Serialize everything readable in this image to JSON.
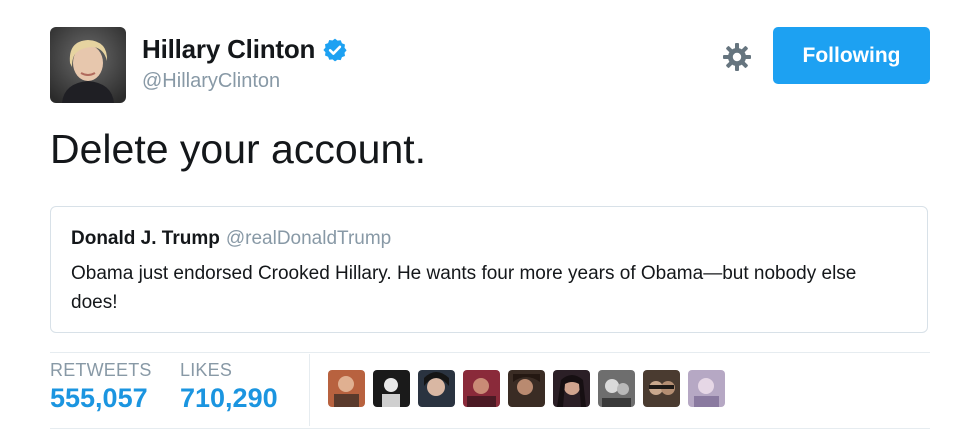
{
  "author": {
    "display_name": "Hillary Clinton",
    "screen_name": "@HillaryClinton",
    "verified": true
  },
  "follow_button": {
    "label": "Following"
  },
  "tweet": {
    "text": "Delete your account."
  },
  "quoted_tweet": {
    "display_name": "Donald J. Trump",
    "screen_name": "@realDonaldTrump",
    "text": "Obama just endorsed Crooked Hillary. He wants four more years of Obama—but nobody else does!"
  },
  "stats": {
    "retweets_label": "RETWEETS",
    "retweets_value": "555,057",
    "likes_label": "LIKES",
    "likes_value": "710,290"
  },
  "likers": [
    {
      "name": "liker-avatar-1"
    },
    {
      "name": "liker-avatar-2"
    },
    {
      "name": "liker-avatar-3"
    },
    {
      "name": "liker-avatar-4"
    },
    {
      "name": "liker-avatar-5"
    },
    {
      "name": "liker-avatar-6"
    },
    {
      "name": "liker-avatar-7"
    },
    {
      "name": "liker-avatar-8"
    },
    {
      "name": "liker-avatar-9"
    }
  ],
  "icons": {
    "verified": "verified-badge-icon",
    "settings": "gear-icon"
  },
  "colors": {
    "accent": "#1da1f2",
    "count": "#1b95e0",
    "secondary_text": "#8899a6",
    "border": "#d8e1e8"
  }
}
